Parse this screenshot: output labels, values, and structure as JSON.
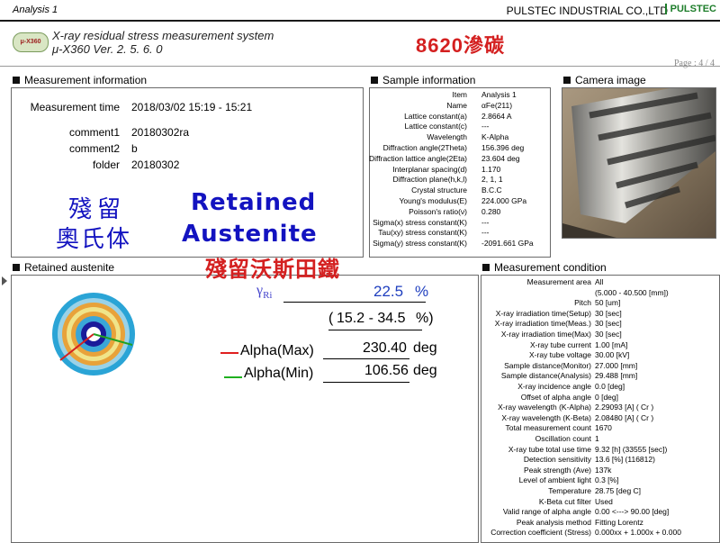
{
  "header": {
    "analysis_label": "Analysis 1",
    "company": "PULSTEC INDUSTRIAL CO.,LTD",
    "brand": "PULSTEC",
    "logo_text": "μ-X360",
    "system_title": "X-ray residual stress measurement system",
    "version": "μ-X360  Ver. 2. 5. 6. 0",
    "red_title": "8620滲碳",
    "page": "Page : 4 / 4"
  },
  "measurement_info": {
    "title": "Measurement information",
    "rows": [
      {
        "k": "Measurement time",
        "v": "2018/03/02  15:19 - 15:21"
      },
      {
        "k": "comment1",
        "v": "20180302ra"
      },
      {
        "k": "comment2",
        "v": "b"
      },
      {
        "k": "folder",
        "v": "20180302"
      }
    ]
  },
  "overlay": {
    "cjk_line1": "殘留",
    "cjk_line2": "奧氏体",
    "en_line1": "Retained",
    "en_line2": "Austenite",
    "red_cjk": "殘留沃斯田鐵"
  },
  "sample_info": {
    "title": "Sample information",
    "rows": [
      {
        "k": "Item",
        "v": "Analysis 1"
      },
      {
        "k": "Name",
        "v": "αFe(211)"
      },
      {
        "k": "Lattice constant(a)",
        "v": "2.8664 A"
      },
      {
        "k": "Lattice constant(c)",
        "v": "---"
      },
      {
        "k": "Wavelength",
        "v": "K-Alpha"
      },
      {
        "k": "Diffraction angle(2Theta)",
        "v": "156.396 deg"
      },
      {
        "k": "Diffraction lattice angle(2Eta)",
        "v": "23.604 deg"
      },
      {
        "k": "Interplanar spacing(d)",
        "v": "1.170"
      },
      {
        "k": "Diffraction plane(h,k,l)",
        "v": "2, 1, 1"
      },
      {
        "k": "Crystal structure",
        "v": "B.C.C"
      },
      {
        "k": "Young's modulus(E)",
        "v": "224.000 GPa"
      },
      {
        "k": "Poisson's ratio(ν)",
        "v": "0.280"
      },
      {
        "k": "Sigma(x) stress constant(K)",
        "v": "---"
      },
      {
        "k": "Tau(xy) stress constant(K)",
        "v": "---"
      },
      {
        "k": "Sigma(y) stress constant(K)",
        "v": "-2091.661 GPa"
      }
    ]
  },
  "camera": {
    "title": "Camera image"
  },
  "retained": {
    "title": "Retained austenite",
    "gamma_label": "γRi",
    "gamma_value": "22.5",
    "gamma_unit": "%",
    "range_open": "(",
    "range_value": "15.2 - 34.5",
    "range_close": "%)",
    "alpha_max_label": "Alpha(Max)",
    "alpha_max_value": "230.40",
    "alpha_min_label": "Alpha(Min)",
    "alpha_min_value": "106.56",
    "deg": "deg",
    "colors": {
      "max": "#e02020",
      "min": "#20b020"
    }
  },
  "meas_cond": {
    "title": "Measurement condition",
    "rows": [
      {
        "k": "Measurement area",
        "v": "All"
      },
      {
        "k": "",
        "v": "(5.000 - 40.500 [mm])"
      },
      {
        "k": "Pitch",
        "v": "50 [um]"
      },
      {
        "k": "X-ray irradiation time(Setup)",
        "v": "30 [sec]"
      },
      {
        "k": "X-ray irradiation time(Meas.)",
        "v": "30 [sec]"
      },
      {
        "k": "X-ray irradiation time(Max)",
        "v": "30 [sec]"
      },
      {
        "k": "X-ray tube current",
        "v": "1.00 [mA]"
      },
      {
        "k": "X-ray tube voltage",
        "v": "30.00 [kV]"
      },
      {
        "k": "Sample distance(Monitor)",
        "v": "27.000 [mm]"
      },
      {
        "k": "Sample distance(Analysis)",
        "v": "29.488 [mm]"
      },
      {
        "k": "X-ray incidence angle",
        "v": "0.0 [deg]"
      },
      {
        "k": "Offset of alpha angle",
        "v": "0 [deg]"
      },
      {
        "k": "X-ray wavelength (K-Alpha)",
        "v": "2.29093 [A] ( Cr )"
      },
      {
        "k": "X-ray wavelength (K-Beta)",
        "v": "2.08480 [A] ( Cr )"
      },
      {
        "k": "Total measurement count",
        "v": "1670"
      },
      {
        "k": "Oscillation count",
        "v": "1"
      },
      {
        "k": "X-ray tube total use time",
        "v": "9.32 [h] (33555 [sec])"
      },
      {
        "k": "Detection sensitivity",
        "v": "13.6 [%] (116812)"
      },
      {
        "k": "Peak strength (Ave)",
        "v": "137k"
      },
      {
        "k": "Level of ambient light",
        "v": "0.3 [%]"
      },
      {
        "k": "Temperature",
        "v": "28.75 [deg C]"
      },
      {
        "k": "K-Beta cut filter",
        "v": "Used"
      },
      {
        "k": "Valid range of alpha angle",
        "v": "0.00 <---> 90.00 [deg]"
      },
      {
        "k": "Peak analysis method",
        "v": "Fitting Lorentz"
      },
      {
        "k": "Correction coefficient (Stress)",
        "v": "0.000xx + 1.000x + 0.000"
      }
    ]
  }
}
